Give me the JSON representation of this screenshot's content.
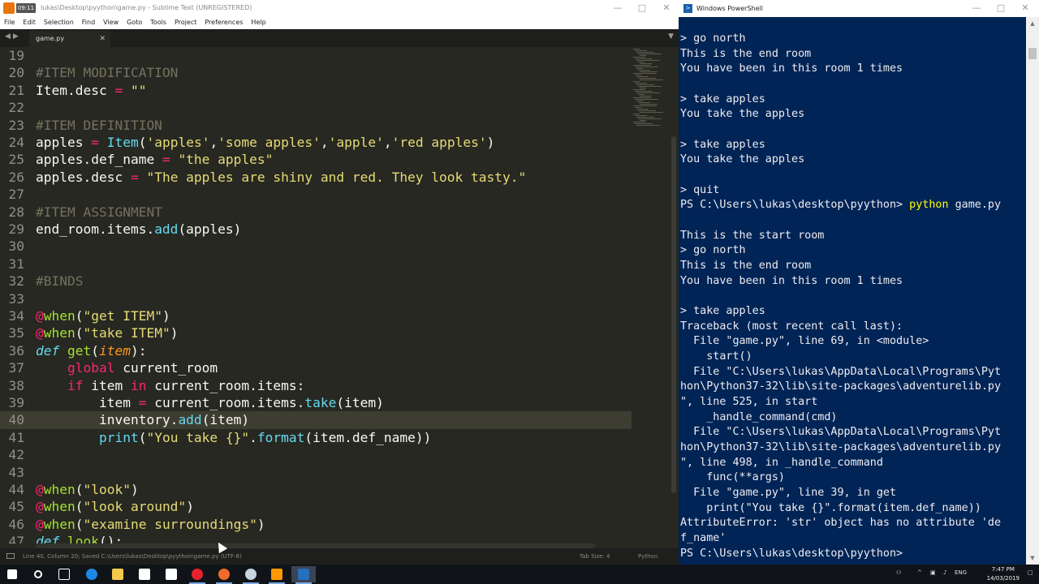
{
  "sublime": {
    "title": "lukas\\Desktop\\pyython\\game.py - Sublime Text (UNREGISTERED)",
    "badge": "09:11",
    "menu": [
      "File",
      "Edit",
      "Selection",
      "Find",
      "View",
      "Goto",
      "Tools",
      "Project",
      "Preferences",
      "Help"
    ],
    "tab_label": "game.py",
    "status_left": "Line 40, Column 20; Saved C:\\Users\\lukas\\Desktop\\pyython\\game.py (UTF-8)",
    "tab_size": "Tab Size: 4",
    "syntax": "Python",
    "active_line": 40,
    "lines": [
      {
        "n": "19",
        "t": []
      },
      {
        "n": "20",
        "t": [
          [
            "#ITEM MODIFICATION",
            "cm"
          ]
        ]
      },
      {
        "n": "21",
        "t": [
          [
            "Item.desc ",
            ""
          ],
          [
            "=",
            "kw"
          ],
          [
            " ",
            ""
          ],
          [
            "\"\"",
            "str"
          ]
        ]
      },
      {
        "n": "22",
        "t": []
      },
      {
        "n": "23",
        "t": [
          [
            "#ITEM DEFINITION",
            "cm"
          ]
        ]
      },
      {
        "n": "24",
        "t": [
          [
            "apples ",
            ""
          ],
          [
            "=",
            "kw"
          ],
          [
            " ",
            ""
          ],
          [
            "Item",
            "fn"
          ],
          [
            "(",
            ""
          ],
          [
            "'apples'",
            "str"
          ],
          [
            ",",
            ""
          ],
          [
            "'some apples'",
            "str"
          ],
          [
            ",",
            ""
          ],
          [
            "'apple'",
            "str"
          ],
          [
            ",",
            ""
          ],
          [
            "'red apples'",
            "str"
          ],
          [
            ")",
            ""
          ]
        ]
      },
      {
        "n": "25",
        "t": [
          [
            "apples.def_name ",
            ""
          ],
          [
            "=",
            "kw"
          ],
          [
            " ",
            ""
          ],
          [
            "\"the apples\"",
            "str"
          ]
        ]
      },
      {
        "n": "26",
        "t": [
          [
            "apples.desc ",
            ""
          ],
          [
            "=",
            "kw"
          ],
          [
            " ",
            ""
          ],
          [
            "\"The apples are shiny and red. They look tasty.\"",
            "str"
          ]
        ]
      },
      {
        "n": "27",
        "t": []
      },
      {
        "n": "28",
        "t": [
          [
            "#ITEM ASSIGNMENT",
            "cm"
          ]
        ]
      },
      {
        "n": "29",
        "t": [
          [
            "end_room.items.",
            ""
          ],
          [
            "add",
            "fn"
          ],
          [
            "(apples)",
            ""
          ]
        ]
      },
      {
        "n": "30",
        "t": []
      },
      {
        "n": "31",
        "t": []
      },
      {
        "n": "32",
        "t": [
          [
            "#BINDS",
            "cm"
          ]
        ]
      },
      {
        "n": "33",
        "t": []
      },
      {
        "n": "34",
        "t": [
          [
            "@",
            "kw"
          ],
          [
            "when",
            "name"
          ],
          [
            "(",
            ""
          ],
          [
            "\"get ITEM\"",
            "str"
          ],
          [
            ")",
            ""
          ]
        ]
      },
      {
        "n": "35",
        "t": [
          [
            "@",
            "kw"
          ],
          [
            "when",
            "name"
          ],
          [
            "(",
            ""
          ],
          [
            "\"take ITEM\"",
            "str"
          ],
          [
            ")",
            ""
          ]
        ]
      },
      {
        "n": "36",
        "t": [
          [
            "def",
            "def"
          ],
          [
            " ",
            ""
          ],
          [
            "get",
            "name"
          ],
          [
            "(",
            ""
          ],
          [
            "item",
            "it"
          ],
          [
            "):",
            ""
          ]
        ]
      },
      {
        "n": "37",
        "t": [
          [
            "    ",
            ""
          ],
          [
            "global",
            "kw"
          ],
          [
            " current_room",
            ""
          ]
        ]
      },
      {
        "n": "38",
        "t": [
          [
            "    ",
            ""
          ],
          [
            "if",
            "kw"
          ],
          [
            " item ",
            ""
          ],
          [
            "in",
            "kw"
          ],
          [
            " current_room.items:",
            ""
          ]
        ]
      },
      {
        "n": "39",
        "t": [
          [
            "        item ",
            ""
          ],
          [
            "=",
            "kw"
          ],
          [
            " current_room.items.",
            ""
          ],
          [
            "take",
            "fn"
          ],
          [
            "(item)",
            ""
          ]
        ]
      },
      {
        "n": "40",
        "t": [
          [
            "        inventory.",
            ""
          ],
          [
            "add",
            "fn"
          ],
          [
            "(item)",
            ""
          ]
        ]
      },
      {
        "n": "41",
        "t": [
          [
            "        ",
            ""
          ],
          [
            "print",
            "fn"
          ],
          [
            "(",
            ""
          ],
          [
            "\"You take {}\"",
            "str"
          ],
          [
            ".",
            ""
          ],
          [
            "format",
            "fn"
          ],
          [
            "(item.def_name))",
            ""
          ]
        ]
      },
      {
        "n": "42",
        "t": []
      },
      {
        "n": "43",
        "t": []
      },
      {
        "n": "44",
        "t": [
          [
            "@",
            "kw"
          ],
          [
            "when",
            "name"
          ],
          [
            "(",
            ""
          ],
          [
            "\"look\"",
            "str"
          ],
          [
            ")",
            ""
          ]
        ]
      },
      {
        "n": "45",
        "t": [
          [
            "@",
            "kw"
          ],
          [
            "when",
            "name"
          ],
          [
            "(",
            ""
          ],
          [
            "\"look around\"",
            "str"
          ],
          [
            ")",
            ""
          ]
        ]
      },
      {
        "n": "46",
        "t": [
          [
            "@",
            "kw"
          ],
          [
            "when",
            "name"
          ],
          [
            "(",
            ""
          ],
          [
            "\"examine surroundings\"",
            "str"
          ],
          [
            ")",
            ""
          ]
        ]
      },
      {
        "n": "47",
        "t": [
          [
            "def",
            "def"
          ],
          [
            " ",
            ""
          ],
          [
            "look",
            "name"
          ],
          [
            "():",
            ""
          ]
        ]
      }
    ]
  },
  "powershell": {
    "title": "Windows PowerShell",
    "lines": [
      {
        "t": "> go north"
      },
      {
        "t": "This is the end room"
      },
      {
        "t": "You have been in this room 1 times"
      },
      {
        "t": ""
      },
      {
        "t": "> take apples"
      },
      {
        "t": "You take the apples"
      },
      {
        "t": ""
      },
      {
        "t": "> take apples"
      },
      {
        "t": "You take the apples"
      },
      {
        "t": ""
      },
      {
        "t": "> quit"
      },
      {
        "t": "PS C:\\Users\\lukas\\desktop\\pyython> ",
        "cmd": "python",
        "rest": " game.py"
      },
      {
        "t": ""
      },
      {
        "t": "This is the start room"
      },
      {
        "t": "> go north"
      },
      {
        "t": "This is the end room"
      },
      {
        "t": "You have been in this room 1 times"
      },
      {
        "t": ""
      },
      {
        "t": "> take apples"
      },
      {
        "t": "Traceback (most recent call last):"
      },
      {
        "t": "  File \"game.py\", line 69, in <module>"
      },
      {
        "t": "    start()"
      },
      {
        "t": "  File \"C:\\Users\\lukas\\AppData\\Local\\Programs\\Pyt"
      },
      {
        "t": "hon\\Python37-32\\lib\\site-packages\\adventurelib.py"
      },
      {
        "t": "\", line 525, in start"
      },
      {
        "t": "    _handle_command(cmd)"
      },
      {
        "t": "  File \"C:\\Users\\lukas\\AppData\\Local\\Programs\\Pyt"
      },
      {
        "t": "hon\\Python37-32\\lib\\site-packages\\adventurelib.py"
      },
      {
        "t": "\", line 498, in _handle_command"
      },
      {
        "t": "    func(**args)"
      },
      {
        "t": "  File \"game.py\", line 39, in get"
      },
      {
        "t": "    print(\"You take {}\".format(item.def_name))"
      },
      {
        "t": "AttributeError: 'str' object has no attribute 'de"
      },
      {
        "t": "f_name'"
      },
      {
        "t": "PS C:\\Users\\lukas\\desktop\\pyython>"
      }
    ]
  },
  "taskbar": {
    "apps": [
      {
        "name": "start-button",
        "color": "#ffffff"
      },
      {
        "name": "search-icon",
        "color": "#ffffff"
      },
      {
        "name": "task-view-icon",
        "color": "#ffffff"
      },
      {
        "name": "edge-icon",
        "color": "#1e88e5"
      },
      {
        "name": "file-explorer-icon",
        "color": "#f2c94c"
      },
      {
        "name": "store-icon",
        "color": "#ffffff"
      },
      {
        "name": "mail-icon",
        "color": "#ffffff"
      },
      {
        "name": "opera-icon",
        "color": "#e5232e"
      },
      {
        "name": "origin-icon",
        "color": "#f26b2a"
      },
      {
        "name": "steam-icon",
        "color": "#c7d5e0"
      },
      {
        "name": "sublime-text-icon",
        "color": "#ff9800"
      },
      {
        "name": "powershell-icon",
        "color": "#2671be"
      }
    ],
    "language": "ENG",
    "time": "7:47 PM",
    "date": "14/03/2019"
  }
}
